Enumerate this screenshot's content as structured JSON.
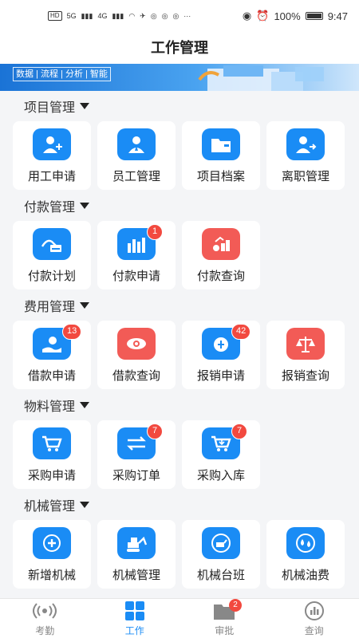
{
  "statusbar": {
    "left_chip": "HD",
    "net_a": "5G",
    "net_b": "4G",
    "battery": "100%",
    "time": "9:47"
  },
  "header": {
    "title": "工作管理"
  },
  "banner": {
    "tags": "数据 | 流程 | 分析 | 智能"
  },
  "sections": [
    {
      "title": "项目管理",
      "items": [
        {
          "label": "用工申请",
          "icon": "user-add-icon",
          "color": "#1a8cf5"
        },
        {
          "label": "员工管理",
          "icon": "employee-icon",
          "color": "#1a8cf5"
        },
        {
          "label": "项目档案",
          "icon": "folder-icon",
          "color": "#1a8cf5"
        },
        {
          "label": "离职管理",
          "icon": "user-leave-icon",
          "color": "#1a8cf5"
        }
      ]
    },
    {
      "title": "付款管理",
      "items": [
        {
          "label": "付款计划",
          "icon": "card-payment-icon",
          "color": "#1a8cf5"
        },
        {
          "label": "付款申请",
          "icon": "bar-chart-icon",
          "color": "#1a8cf5",
          "badge": "1"
        },
        {
          "label": "付款查询",
          "icon": "money-growth-icon",
          "color": "#f25b56"
        }
      ]
    },
    {
      "title": "费用管理",
      "items": [
        {
          "label": "借款申请",
          "icon": "hand-money-icon",
          "color": "#1a8cf5",
          "badge": "13"
        },
        {
          "label": "借款查询",
          "icon": "money-eye-icon",
          "color": "#f25b56"
        },
        {
          "label": "报销申请",
          "icon": "coin-bag-icon",
          "color": "#1a8cf5",
          "badge": "42"
        },
        {
          "label": "报销查询",
          "icon": "scale-icon",
          "color": "#f25b56"
        }
      ]
    },
    {
      "title": "物料管理",
      "items": [
        {
          "label": "采购申请",
          "icon": "cart-icon",
          "color": "#1a8cf5"
        },
        {
          "label": "采购订单",
          "icon": "transfer-icon",
          "color": "#1a8cf5",
          "badge": "7"
        },
        {
          "label": "采购入库",
          "icon": "cart-in-icon",
          "color": "#1a8cf5",
          "badge": "7"
        }
      ]
    },
    {
      "title": "机械管理",
      "items": [
        {
          "label": "新增机械",
          "icon": "plus-icon",
          "color": "#1a8cf5"
        },
        {
          "label": "机械管理",
          "icon": "excavator-icon",
          "color": "#1a8cf5"
        },
        {
          "label": "机械台班",
          "icon": "machine-shift-icon",
          "color": "#1a8cf5"
        },
        {
          "label": "机械油费",
          "icon": "oil-drop-icon",
          "color": "#1a8cf5"
        }
      ]
    }
  ],
  "tabbar": {
    "tabs": [
      {
        "label": "考勤",
        "icon": "signal-icon",
        "active": false
      },
      {
        "label": "工作",
        "icon": "grid-icon",
        "active": true
      },
      {
        "label": "审批",
        "icon": "approval-folder-icon",
        "active": false,
        "badge": "2"
      },
      {
        "label": "查询",
        "icon": "query-chart-icon",
        "active": false
      }
    ]
  },
  "colors": {
    "primary": "#1a8cf5",
    "accent_red": "#f25b56",
    "badge": "#f2493f"
  }
}
